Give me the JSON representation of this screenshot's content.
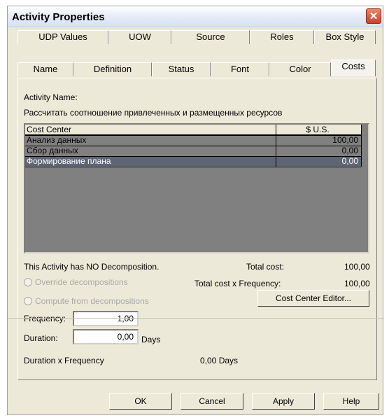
{
  "window": {
    "title": "Activity Properties",
    "close_symbol": "✕"
  },
  "tabs": {
    "row1": [
      "UDP Values",
      "UOW",
      "Source",
      "Roles",
      "Box Style"
    ],
    "row2": [
      "Name",
      "Definition",
      "Status",
      "Font",
      "Color",
      "Costs"
    ],
    "active": "Costs"
  },
  "costs": {
    "activity_name_label": "Activity Name:",
    "activity_name_value": "Рассчитать соотношение  привлеченных и  размещенных ресурсов",
    "table": {
      "headers": [
        "Cost Center",
        "$ U.S."
      ],
      "rows": [
        {
          "center": "Анализ данных",
          "value": "100,00"
        },
        {
          "center": "Сбор данных",
          "value": "0,00"
        },
        {
          "center": "Формирование плана",
          "value": "0,00"
        }
      ]
    },
    "decomposition_text": "This Activity has NO Decomposition.",
    "override_label": "Override decompositions",
    "compute_label": "Compute from decompositions",
    "total_cost_label": "Total cost:",
    "total_cost_value": "100,00",
    "total_cost_freq_label": "Total cost x Frequency:",
    "total_cost_freq_value": "100,00",
    "cost_center_editor_label": "Cost Center Editor...",
    "frequency_label": "Frequency:",
    "frequency_value": "1,00",
    "duration_label": "Duration:",
    "duration_value": "0,00",
    "duration_unit": "Days",
    "duration_freq_label": "Duration x Frequency",
    "duration_freq_value": "0,00 Days"
  },
  "buttons": {
    "ok": "OK",
    "cancel": "Cancel",
    "apply": "Apply",
    "help": "Help"
  }
}
